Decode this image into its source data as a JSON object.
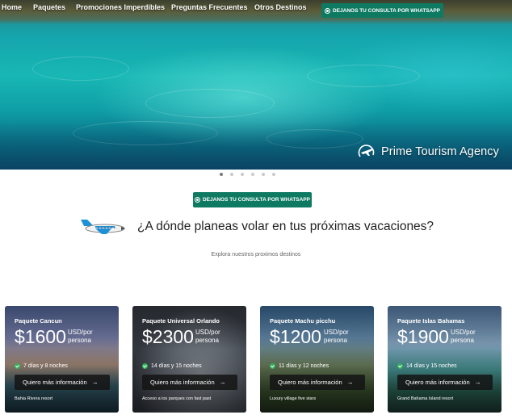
{
  "nav": {
    "items": [
      "Home",
      "Paquetes",
      "Promociones Imperdibles",
      "Preguntas Frecuentes",
      "Otros Destinos"
    ]
  },
  "whatsapp": {
    "header_label": "DEJANOS TU CONSULTA POR WHATSAPP",
    "mid_label": "DEJANOS TU CONSULTA POR WHATSAPP",
    "color": "#0e7a62"
  },
  "brand": {
    "name": "Prime Tourism Agency"
  },
  "carousel": {
    "slides": 6,
    "active": 1
  },
  "headline": "¿A dónde planeas volar en tus próximas vacaciones?",
  "subtext": "Explora nuestros proximos destinos",
  "cards": [
    {
      "title": "Paquete Cancun",
      "price": "$1600",
      "per_1": "USD/por",
      "per_2": "persona",
      "nights": "7 días y 8 noches",
      "cta": "Quiero más información",
      "note": "Bahia Rivera resort"
    },
    {
      "title": "Paquete Universal Orlando",
      "price": "$2300",
      "per_1": "USD/por",
      "per_2": "persona",
      "nights": "14 días y 15 noches",
      "cta": "Quiero más información",
      "note": "Acceso a los parques con fast past"
    },
    {
      "title": "Paquete Machu picchu",
      "price": "$1200",
      "per_1": "USD/por",
      "per_2": "persona",
      "nights": "11 días y 12 noches",
      "cta": "Quiero más información",
      "note": "Luxury village five stars"
    },
    {
      "title": "Paquete Islas Bahamas",
      "price": "$1900",
      "per_1": "USD/por",
      "per_2": "persona",
      "nights": "14 días y 15 noches",
      "cta": "Quiero más información",
      "note": "Grand Bahama Island resort"
    }
  ]
}
